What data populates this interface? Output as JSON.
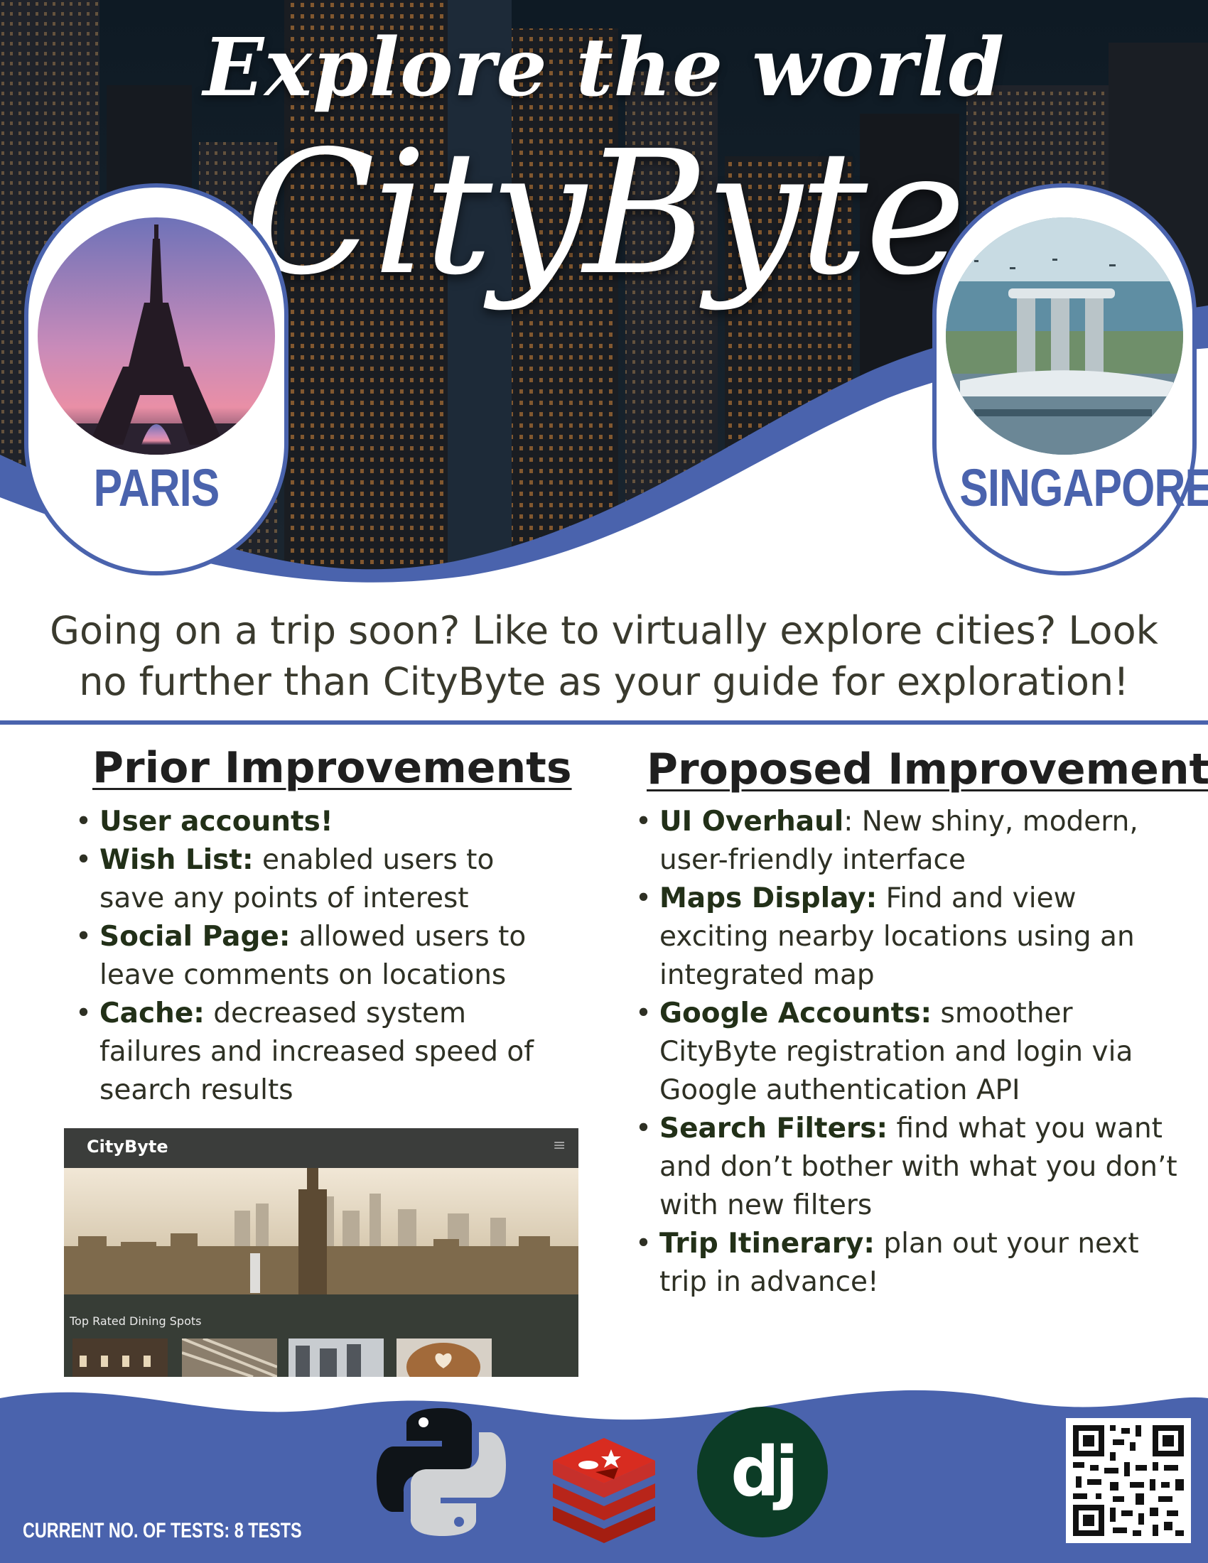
{
  "hero": {
    "tagline": "Explore the world",
    "brand": "CityByte"
  },
  "cities": [
    {
      "name": "PARIS"
    },
    {
      "name": "SINGAPORE"
    }
  ],
  "intro": "Going on a trip soon? Like to virtually explore cities? Look no further than CityByte as your guide for exploration!",
  "prior": {
    "title": "Prior Improvements",
    "items": [
      {
        "name": "User accounts!",
        "desc": ""
      },
      {
        "name": "Wish List:",
        "desc": " enabled users to save any points of interest"
      },
      {
        "name": "Social Page:",
        "desc": " allowed users to leave comments on locations"
      },
      {
        "name": "Cache:",
        "desc": " decreased system failures and increased speed of search results"
      }
    ]
  },
  "proposed": {
    "title": "Proposed Improvements",
    "items": [
      {
        "name": "UI Overhaul",
        "desc": ": New shiny, modern, user-friendly interface"
      },
      {
        "name": "Maps Display:",
        "desc": " Find and view exciting nearby locations using an integrated map"
      },
      {
        "name": "Google Accounts:",
        "desc": " smoother CityByte registration and login via Google authentication API"
      },
      {
        "name": "Search Filters:",
        "desc": " find what you want and don’t bother with what you don’t with new filters"
      },
      {
        "name": "Trip Itinerary:",
        "desc": " plan out your next trip in advance!"
      }
    ]
  },
  "app_screenshot": {
    "brand": "CityByte",
    "menu_glyph": "≡",
    "section_label": "Top Rated Dining Spots"
  },
  "footer": {
    "tests_label": "CURRENT NO. OF TESTS: 8 TESTS",
    "logos": [
      "python-logo",
      "redis-logo",
      "django-logo"
    ],
    "django_text": "dj",
    "qr_label": "qr-code"
  },
  "colors": {
    "accent": "#4a63ad",
    "text_dark": "#2e3024",
    "heading_green": "#223018",
    "django_green": "#0c3c26",
    "redis_red": "#d82c20"
  }
}
